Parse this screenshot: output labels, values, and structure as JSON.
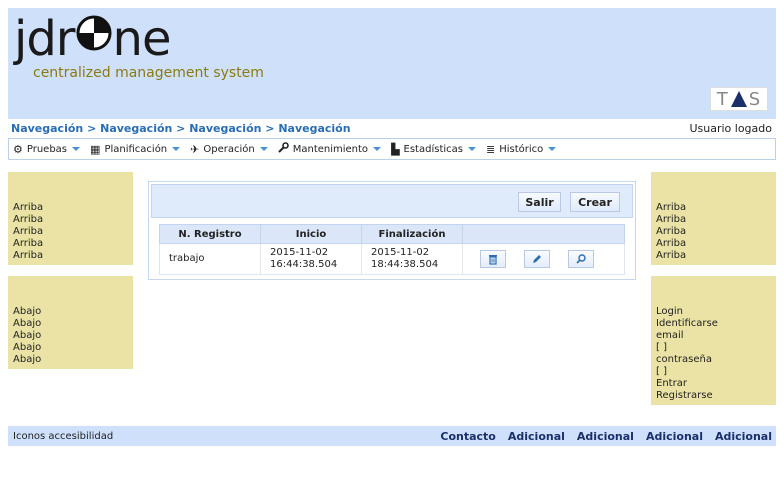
{
  "header": {
    "logo_text_before": "jdr",
    "logo_text_after": "ne",
    "logo_subtitle": "centralized management system",
    "partner_logo_left": "T",
    "partner_logo_right": "S"
  },
  "breadcrumb": {
    "path": "Navegación > Navegación > Navegación > Navegación",
    "user_status": "Usuario logado"
  },
  "menu": [
    {
      "label": "Pruebas",
      "icon": "gear-icon",
      "glyph": "⚙"
    },
    {
      "label": "Planificación",
      "icon": "calendar-icon",
      "glyph": "▦"
    },
    {
      "label": "Operación",
      "icon": "plane-icon",
      "glyph": "✈"
    },
    {
      "label": "Mantenimiento",
      "icon": "wrench-icon",
      "glyph": "🔧"
    },
    {
      "label": "Estadísticas",
      "icon": "chart-icon",
      "glyph": "▙"
    },
    {
      "label": "Histórico",
      "icon": "database-icon",
      "glyph": "≣"
    }
  ],
  "left_top": [
    "Arriba",
    "Arriba",
    "Arriba",
    "Arriba",
    "Arriba"
  ],
  "left_bottom": [
    "Abajo",
    "Abajo",
    "Abajo",
    "Abajo",
    "Abajo"
  ],
  "right_top": [
    "Arriba",
    "Arriba",
    "Arriba",
    "Arriba",
    "Arriba"
  ],
  "login_box": [
    "Login",
    "Identificarse",
    "email",
    "[ ]",
    "contraseña",
    "[ ]",
    "Entrar",
    "Registrarse"
  ],
  "panel": {
    "salir_label": "Salir",
    "crear_label": "Crear",
    "columns": [
      "N. Registro",
      "Inicio",
      "Finalización",
      ""
    ],
    "rows": [
      {
        "registro": "trabajo",
        "inicio": "2015-11-02 16:44:38.504",
        "finalizacion": "2015-11-02 18:44:38.504"
      }
    ],
    "row_actions": [
      "trash-icon",
      "pencil-icon",
      "magnifier-icon"
    ]
  },
  "footer": {
    "accessibility": "Iconos accesibilidad",
    "links": [
      "Contacto",
      "Adicional",
      "Adicional",
      "Adicional",
      "Adicional"
    ]
  },
  "colors": {
    "header_bg": "#cfe0fb",
    "side_bg": "#ebe3a6",
    "link_blue": "#2a6db3",
    "dark_navy": "#1b2f68"
  }
}
